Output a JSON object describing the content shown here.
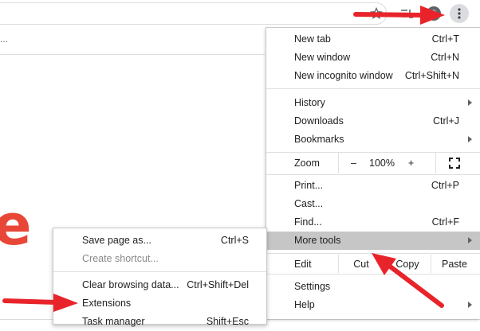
{
  "menu": {
    "items_group1": [
      {
        "label": "New tab",
        "shortcut": "Ctrl+T"
      },
      {
        "label": "New window",
        "shortcut": "Ctrl+N"
      },
      {
        "label": "New incognito window",
        "shortcut": "Ctrl+Shift+N"
      }
    ],
    "items_group2": [
      {
        "label": "History",
        "shortcut": ""
      },
      {
        "label": "Downloads",
        "shortcut": "Ctrl+J"
      },
      {
        "label": "Bookmarks",
        "shortcut": ""
      }
    ],
    "zoom": {
      "label": "Zoom",
      "minus": "–",
      "value": "100%",
      "plus": "+"
    },
    "items_group3": [
      {
        "label": "Print...",
        "shortcut": "Ctrl+P"
      },
      {
        "label": "Cast...",
        "shortcut": ""
      },
      {
        "label": "Find...",
        "shortcut": "Ctrl+F"
      },
      {
        "label": "More tools",
        "shortcut": ""
      }
    ],
    "edit": {
      "label": "Edit",
      "cut": "Cut",
      "copy": "Copy",
      "paste": "Paste"
    },
    "items_group4": [
      {
        "label": "Settings",
        "shortcut": ""
      },
      {
        "label": "Help",
        "shortcut": ""
      }
    ]
  },
  "submenu": {
    "items": [
      {
        "label": "Save page as...",
        "shortcut": "Ctrl+S"
      },
      {
        "label": "Create shortcut...",
        "shortcut": ""
      },
      {
        "label": "Clear browsing data...",
        "shortcut": "Ctrl+Shift+Del"
      },
      {
        "label": "Extensions",
        "shortcut": ""
      },
      {
        "label": "Task manager",
        "shortcut": "Shift+Esc"
      }
    ]
  },
  "page": {
    "logo_letter": "e",
    "pagebar_text": "..."
  },
  "colors": {
    "accent_red": "#e8242a",
    "highlight": "#c6c6c6",
    "logo": "#e84637"
  },
  "icons": [
    "star-icon",
    "reading-list-icon",
    "profile-avatar-icon",
    "more-vert-icon",
    "fullscreen-icon",
    "submenu-arrow-icon"
  ]
}
